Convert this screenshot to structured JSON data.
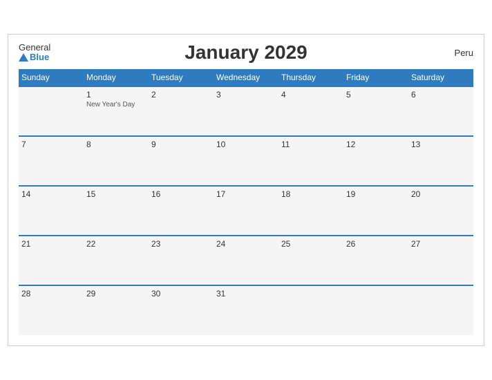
{
  "header": {
    "logo_general": "General",
    "logo_blue": "Blue",
    "title": "January 2029",
    "country": "Peru"
  },
  "weekdays": [
    "Sunday",
    "Monday",
    "Tuesday",
    "Wednesday",
    "Thursday",
    "Friday",
    "Saturday"
  ],
  "weeks": [
    [
      {
        "day": "",
        "empty": true
      },
      {
        "day": "1",
        "holiday": "New Year's Day"
      },
      {
        "day": "2"
      },
      {
        "day": "3"
      },
      {
        "day": "4"
      },
      {
        "day": "5"
      },
      {
        "day": "6"
      }
    ],
    [
      {
        "day": "7"
      },
      {
        "day": "8"
      },
      {
        "day": "9"
      },
      {
        "day": "10"
      },
      {
        "day": "11"
      },
      {
        "day": "12"
      },
      {
        "day": "13"
      }
    ],
    [
      {
        "day": "14"
      },
      {
        "day": "15"
      },
      {
        "day": "16"
      },
      {
        "day": "17"
      },
      {
        "day": "18"
      },
      {
        "day": "19"
      },
      {
        "day": "20"
      }
    ],
    [
      {
        "day": "21"
      },
      {
        "day": "22"
      },
      {
        "day": "23"
      },
      {
        "day": "24"
      },
      {
        "day": "25"
      },
      {
        "day": "26"
      },
      {
        "day": "27"
      }
    ],
    [
      {
        "day": "28"
      },
      {
        "day": "29"
      },
      {
        "day": "30"
      },
      {
        "day": "31"
      },
      {
        "day": "",
        "empty": true
      },
      {
        "day": "",
        "empty": true
      },
      {
        "day": "",
        "empty": true
      }
    ]
  ]
}
